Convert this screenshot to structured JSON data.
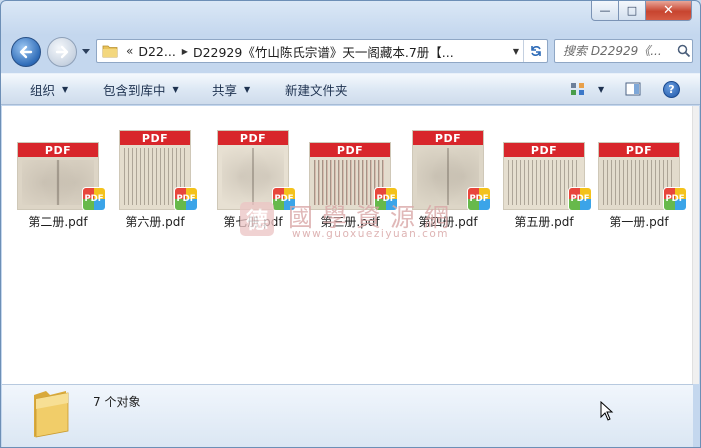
{
  "window": {
    "caption_buttons": {
      "minimize": "—",
      "maximize": "□",
      "close": "✕"
    }
  },
  "nav": {
    "back_icon": "back-arrow-icon",
    "forward_icon": "forward-arrow-icon"
  },
  "address": {
    "chevron": "«",
    "crumbs": [
      "D22...",
      "D22929《竹山陈氏宗谱》天一阁藏本.7册【..."
    ]
  },
  "search": {
    "placeholder": "搜索 D22929《..."
  },
  "toolbar": {
    "organize": "组织",
    "include_library": "包含到库中",
    "share": "共享",
    "new_folder": "新建文件夹",
    "help": "?"
  },
  "files": [
    {
      "name": "第二册.pdf",
      "band": "PDF",
      "badge": "PDF",
      "tone": "#ddd5c6"
    },
    {
      "name": "第六册.pdf",
      "band": "PDF",
      "badge": "PDF",
      "tone": "#e4ddcd"
    },
    {
      "name": "第七册.pdf",
      "band": "PDF",
      "badge": "PDF",
      "tone": "#e7e0d2"
    },
    {
      "name": "第三册.pdf",
      "band": "PDF",
      "badge": "PDF",
      "tone": "#e3dccd"
    },
    {
      "name": "第四册.pdf",
      "band": "PDF",
      "badge": "PDF",
      "tone": "#ddd6c7"
    },
    {
      "name": "第五册.pdf",
      "band": "PDF",
      "badge": "PDF",
      "tone": "#e6dfd0"
    },
    {
      "name": "第一册.pdf",
      "band": "PDF",
      "badge": "PDF",
      "tone": "#e2dbcc"
    }
  ],
  "watermark": {
    "seal": "德",
    "text": "國學資源網",
    "url": "www.guoxueziyuan.com"
  },
  "details": {
    "count": "7 个对象"
  }
}
